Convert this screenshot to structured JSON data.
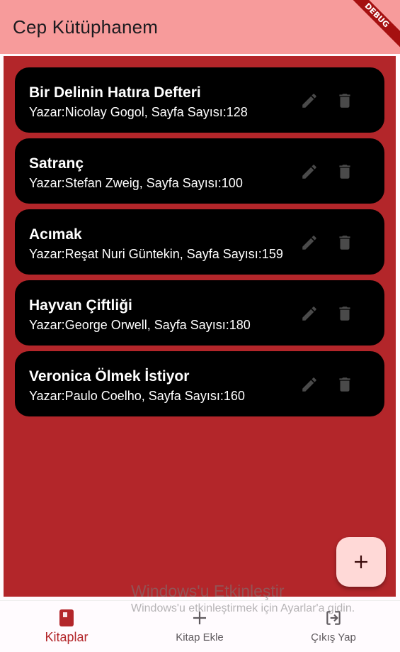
{
  "appbar": {
    "title": "Cep Kütüphanem",
    "debug_label": "DEBUG"
  },
  "books": [
    {
      "title": "Bir Delinin Hatıra Defteri",
      "subtitle": "Yazar:Nicolay Gogol, Sayfa Sayısı:128"
    },
    {
      "title": "Satranç",
      "subtitle": "Yazar:Stefan Zweig, Sayfa Sayısı:100"
    },
    {
      "title": "Acımak",
      "subtitle": "Yazar:Reşat Nuri Güntekin, Sayfa Sayısı:159"
    },
    {
      "title": "Hayvan Çiftliği",
      "subtitle": "Yazar:George Orwell, Sayfa Sayısı:180"
    },
    {
      "title": "Veronica Ölmek İstiyor",
      "subtitle": "Yazar:Paulo Coelho, Sayfa Sayısı:160"
    }
  ],
  "icons": {
    "edit": "pencil-icon",
    "delete": "trash-icon",
    "fab": "plus-icon"
  },
  "nav": {
    "items": [
      {
        "label": "Kitaplar",
        "icon": "book-icon",
        "active": true
      },
      {
        "label": "Kitap Ekle",
        "icon": "plus-icon",
        "active": false
      },
      {
        "label": "Çıkış Yap",
        "icon": "exit-icon",
        "active": false
      }
    ]
  },
  "watermark": {
    "title": "Windows'u Etkinleştir",
    "subtitle": "Windows'u etkinleştirmek için Ayarlar'a gidin."
  },
  "colors": {
    "appbar": "#f79b9b",
    "content_bg": "#b3262a",
    "card_bg": "#000000",
    "fab_bg": "#ffd9d7",
    "nav_active": "#b3262a"
  }
}
